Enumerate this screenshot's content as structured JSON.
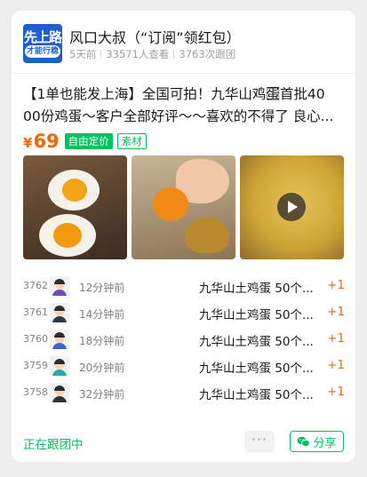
{
  "header": {
    "avatar_text_top": "先上路",
    "avatar_text_bottom": "才能行稳",
    "title": "风口大叔（“订阅”领红包）",
    "meta": {
      "time": "5天前",
      "views": "33571人查看",
      "follow_count": "3763次跟团"
    }
  },
  "post": {
    "headline_line1": "【1单也能发上海】全国可拍！九华山鸡蛋⃞首批40",
    "headline_line2": "00份鸡蛋～客户全部好评～～喜欢的不得了 良心...",
    "price_symbol": "¥",
    "price": "69",
    "tag_free_price": "自由定价",
    "tag_material": "素材"
  },
  "orders": [
    {
      "num": "3762",
      "time": "12分钟前",
      "product": "九华山土鸡蛋 50个...",
      "qty": "+1",
      "body_color": "#6b4fbb"
    },
    {
      "num": "3761",
      "time": "14分钟前",
      "product": "九华山土鸡蛋 50个...",
      "qty": "+1",
      "body_color": "#2f3a4a"
    },
    {
      "num": "3760",
      "time": "18分钟前",
      "product": "九华山土鸡蛋 50个...",
      "qty": "+1",
      "body_color": "#3f64c7"
    },
    {
      "num": "3759",
      "time": "20分钟前",
      "product": "九华山土鸡蛋 50个...",
      "qty": "+1",
      "body_color": "#2aa7a0"
    },
    {
      "num": "3758",
      "time": "32分钟前",
      "product": "九华山土鸡蛋 50个...",
      "qty": "+1",
      "body_color": "#333333"
    }
  ],
  "footer": {
    "following": "正在跟团中",
    "more": "···",
    "share": "分享"
  },
  "colors": {
    "accent_green": "#07c160",
    "price_orange": "#fa6400"
  }
}
